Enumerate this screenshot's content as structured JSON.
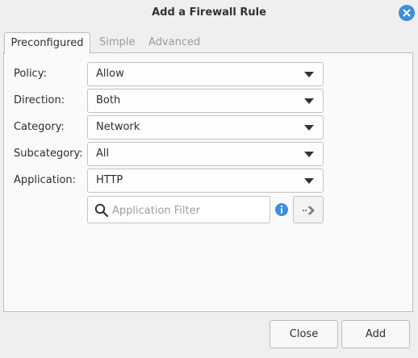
{
  "window": {
    "title": "Add a Firewall Rule"
  },
  "tabs": [
    {
      "label": "Preconfigured",
      "active": true
    },
    {
      "label": "Simple",
      "active": false
    },
    {
      "label": "Advanced",
      "active": false
    }
  ],
  "form": {
    "policy": {
      "label": "Policy:",
      "value": "Allow"
    },
    "direction": {
      "label": "Direction:",
      "value": "Both"
    },
    "category": {
      "label": "Category:",
      "value": "Network"
    },
    "subcategory": {
      "label": "Subcategory:",
      "value": "All"
    },
    "application": {
      "label": "Application:",
      "value": "HTTP"
    },
    "filter": {
      "placeholder": "Application Filter",
      "value": ""
    }
  },
  "icons": {
    "close": "close-icon",
    "search": "search-icon",
    "info": "info-icon",
    "copy_to": "arrow-right-icon"
  },
  "buttons": {
    "close": "Close",
    "add": "Add"
  },
  "colors": {
    "accent": "#3d8fd9"
  }
}
